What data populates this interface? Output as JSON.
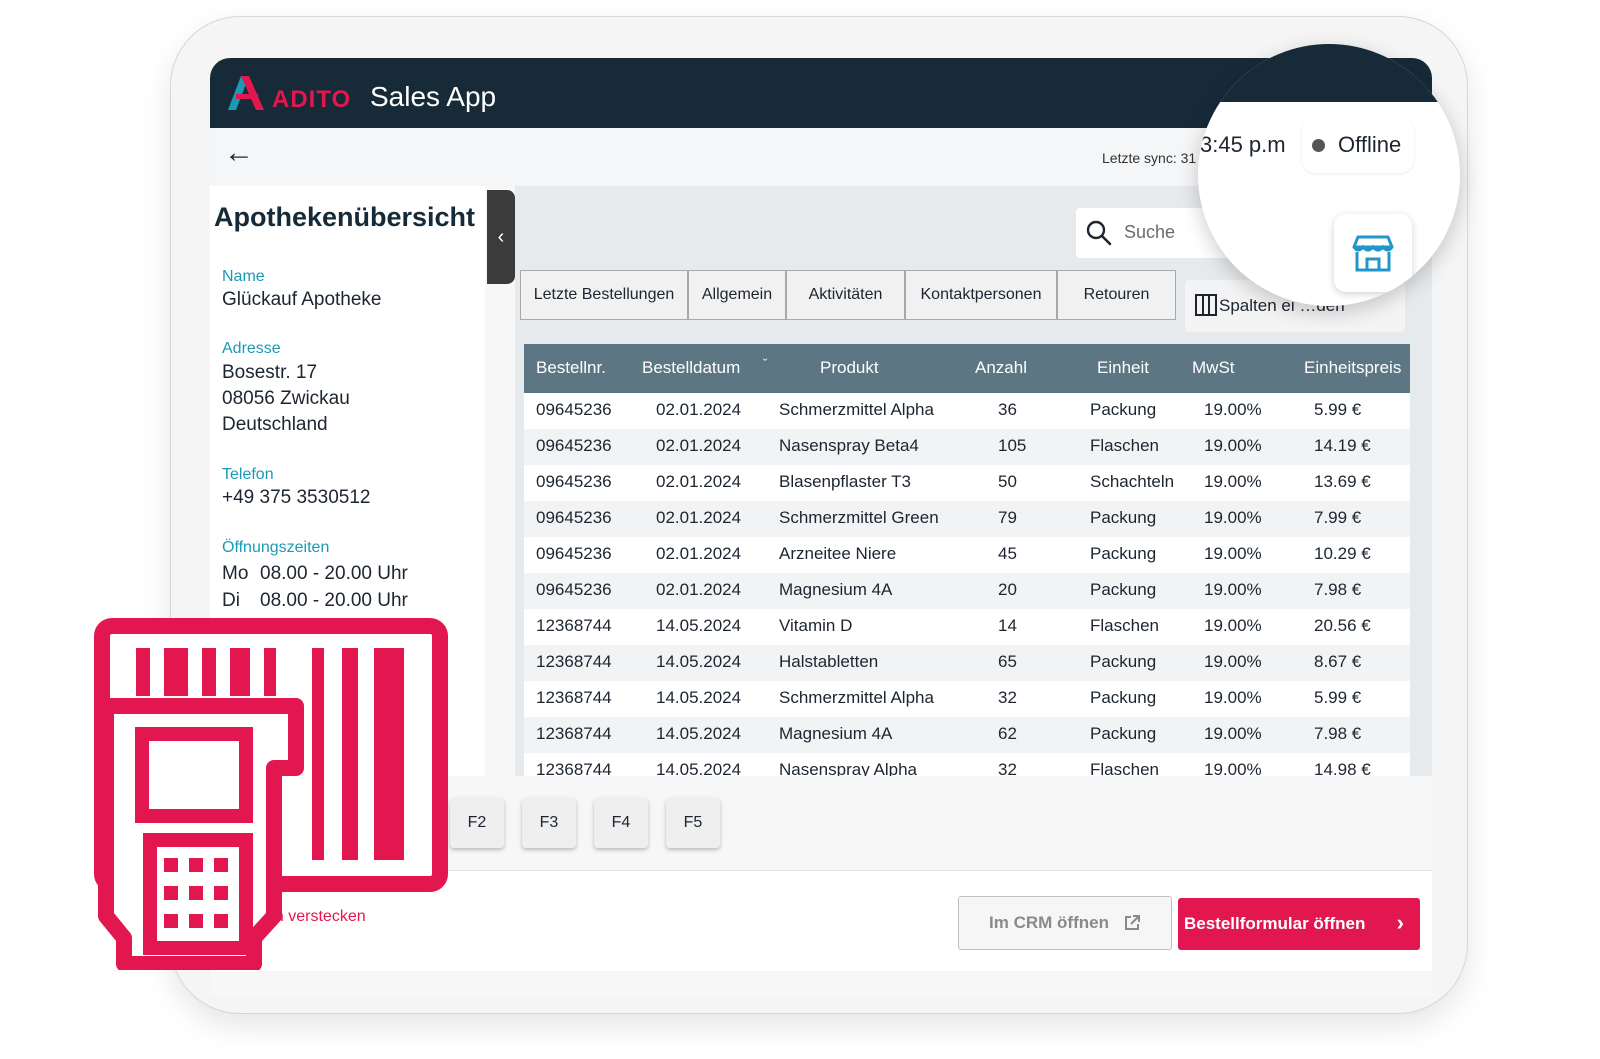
{
  "app": {
    "brand": "ADITO",
    "title": "Sales App"
  },
  "subbar": {
    "back_icon": "←",
    "sync_label": "Letzte sync: 31"
  },
  "status": {
    "time": "3:45 p.m",
    "connection": "Offline"
  },
  "pharmacy": {
    "heading": "Apothekenübersicht",
    "name_label": "Name",
    "name": "Glückauf Apotheke",
    "address_label": "Adresse",
    "address_line1": "Bosestr. 17",
    "address_line2": "08056 Zwickau",
    "address_line3": "Deutschland",
    "phone_label": "Telefon",
    "phone": "+49 375 3530512",
    "hours_label": "Öffnungszeiten",
    "hours": [
      {
        "day": "Mo",
        "time": "08.00 - 20.00 Uhr"
      },
      {
        "day": "Di",
        "time": "08.00 - 20.00 Uhr"
      }
    ]
  },
  "search": {
    "placeholder": "Suche"
  },
  "tabs": [
    "Letzte Bestellungen",
    "Allgemein",
    "Aktivitäten",
    "Kontaktpersonen",
    "Retouren"
  ],
  "columns_button": {
    "label": "Spalten ein/ausblenden",
    "visible_text": "Spalten ei     …den"
  },
  "table": {
    "headers": [
      "Bestellnr.",
      "Bestelldatum",
      "Produkt",
      "Anzahl",
      "Einheit",
      "MwSt",
      "Einheitspreis"
    ],
    "sort_indicator": "ˇ",
    "rows": [
      [
        "09645236",
        "02.01.2024",
        "Schmerzmittel Alpha",
        "36",
        "Packung",
        "19.00%",
        "5.99 €"
      ],
      [
        "09645236",
        "02.01.2024",
        "Nasenspray Beta4",
        "105",
        "Flaschen",
        "19.00%",
        "14.19 €"
      ],
      [
        "09645236",
        "02.01.2024",
        "Blasenpflaster T3",
        "50",
        "Schachteln",
        "19.00%",
        "13.69 €"
      ],
      [
        "09645236",
        "02.01.2024",
        "Schmerzmittel Green",
        "79",
        "Packung",
        "19.00%",
        "7.99 €"
      ],
      [
        "09645236",
        "02.01.2024",
        "Arzneitee Niere",
        "45",
        "Packung",
        "19.00%",
        "10.29 €"
      ],
      [
        "09645236",
        "02.01.2024",
        "Magnesium 4A",
        "20",
        "Packung",
        "19.00%",
        "7.98 €"
      ],
      [
        "12368744",
        "14.05.2024",
        "Vitamin D",
        "14",
        "Flaschen",
        "19.00%",
        "20.56 €"
      ],
      [
        "12368744",
        "14.05.2024",
        "Halstabletten",
        "65",
        "Packung",
        "19.00%",
        "8.67 €"
      ],
      [
        "12368744",
        "14.05.2024",
        "Schmerzmittel Alpha",
        "32",
        "Packung",
        "19.00%",
        "5.99 €"
      ],
      [
        "12368744",
        "14.05.2024",
        "Magnesium 4A",
        "62",
        "Packung",
        "19.00%",
        "7.98 €"
      ],
      [
        "12368744",
        "14.05.2024",
        "Nasenspray Alpha",
        "32",
        "Flaschen",
        "19.00%",
        "14.98 €"
      ]
    ]
  },
  "fkeys": [
    "F2",
    "F3",
    "F4",
    "F5"
  ],
  "footer": {
    "hide_link": "en verstecken",
    "crm_button": "Im CRM öffnen",
    "order_button": "Bestellformular öffnen"
  },
  "icons": {
    "logo": "adito-logo-icon",
    "search": "search-icon",
    "columns": "columns-icon",
    "store": "store-icon",
    "external": "external-link-icon",
    "scanner": "barcode-scanner-icon"
  },
  "colors": {
    "brand_red": "#e3174f",
    "navy": "#172a38",
    "table_header": "#5d7683",
    "accent_teal": "#1a9bb5",
    "store_blue": "#2196c9"
  }
}
